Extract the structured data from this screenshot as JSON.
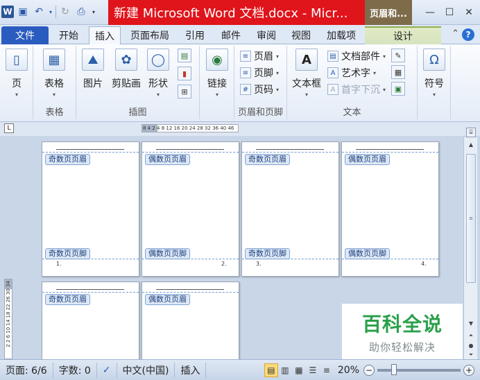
{
  "window": {
    "title": "新建 Microsoft Word 文档.docx - Micr...",
    "context_tab_title": "页眉和..."
  },
  "quick_access": {
    "app_icon": "W"
  },
  "tabs": [
    {
      "label": "文件"
    },
    {
      "label": "开始"
    },
    {
      "label": "插入"
    },
    {
      "label": "页面布局"
    },
    {
      "label": "引用"
    },
    {
      "label": "邮件"
    },
    {
      "label": "审阅"
    },
    {
      "label": "视图"
    },
    {
      "label": "加载项"
    },
    {
      "label": "设计"
    }
  ],
  "ribbon": {
    "pages_button": "页",
    "table_group": {
      "button": "表格",
      "label": "表格"
    },
    "illustrations_group": {
      "picture": "图片",
      "clipart": "剪贴画",
      "shapes": "形状",
      "label": "插图"
    },
    "links_group": {
      "button": "链接"
    },
    "header_footer_group": {
      "header": "页眉",
      "footer": "页脚",
      "page_number": "页码",
      "label": "页眉和页脚"
    },
    "text_group": {
      "textbox": "文本框",
      "quick_parts": "文档部件",
      "wordart": "艺术字",
      "dropcap": "首字下沉",
      "label": "文本"
    },
    "symbols_group": {
      "button": "符号"
    }
  },
  "ruler": {
    "horizontal": "8 4 2 4 8 12 16 20 24 28 32 36 40 46",
    "vertical": "2 2 6 10 14 18 22 26 30 34"
  },
  "pages": [
    {
      "header_label": "奇数页页眉",
      "footer_label": "奇数页页脚",
      "page_number": "1."
    },
    {
      "header_label": "偶数页页眉",
      "footer_label": "偶数页页脚",
      "page_number": "2."
    },
    {
      "header_label": "奇数页页眉",
      "footer_label": "奇数页页脚",
      "page_number": "3."
    },
    {
      "header_label": "偶数页页眉",
      "footer_label": "偶数页页脚",
      "page_number": "4."
    },
    {
      "header_label": "奇数页页眉"
    },
    {
      "header_label": "偶数页页眉"
    }
  ],
  "watermark": {
    "title": "百科全说",
    "subtitle": "助你轻松解决"
  },
  "status": {
    "page": "页面: 6/6",
    "word_count": "字数: 0",
    "language": "中文(中国)",
    "mode": "插入",
    "zoom": "20%"
  }
}
